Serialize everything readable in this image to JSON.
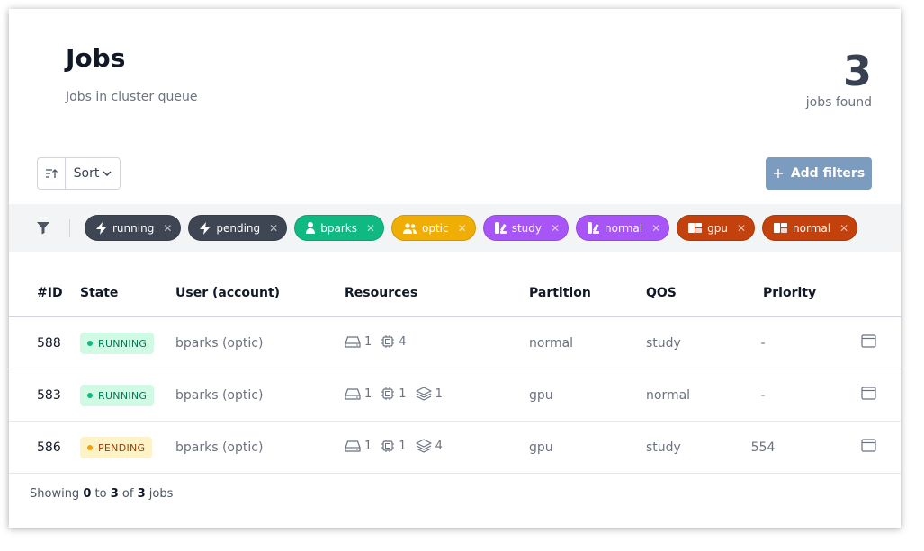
{
  "header": {
    "title": "Jobs",
    "subtitle": "Jobs in cluster queue",
    "count": "3",
    "count_label": "jobs found"
  },
  "toolbar": {
    "sort_label": "Sort",
    "add_filters_label": "Add filters"
  },
  "filters": [
    {
      "label": "running",
      "kind": "state",
      "icon": "bolt-icon"
    },
    {
      "label": "pending",
      "kind": "state",
      "icon": "bolt-icon"
    },
    {
      "label": "bparks",
      "kind": "user",
      "icon": "user-icon"
    },
    {
      "label": "optic",
      "kind": "account",
      "icon": "users-icon"
    },
    {
      "label": "study",
      "kind": "qos",
      "icon": "qos-icon"
    },
    {
      "label": "normal",
      "kind": "qos",
      "icon": "qos-icon"
    },
    {
      "label": "gpu",
      "kind": "partition",
      "icon": "partition-icon"
    },
    {
      "label": "normal",
      "kind": "partition",
      "icon": "partition-icon"
    }
  ],
  "table": {
    "columns": [
      "#ID",
      "State",
      "User (account)",
      "Resources",
      "Partition",
      "QOS",
      "Priority"
    ],
    "rows": [
      {
        "id": "588",
        "state": "RUNNING",
        "user": "bparks (optic)",
        "nodes": "1",
        "cpus": "4",
        "gpus": "",
        "partition": "normal",
        "qos": "study",
        "priority": "-"
      },
      {
        "id": "583",
        "state": "RUNNING",
        "user": "bparks (optic)",
        "nodes": "1",
        "cpus": "1",
        "gpus": "1",
        "partition": "gpu",
        "qos": "normal",
        "priority": "-"
      },
      {
        "id": "586",
        "state": "PENDING",
        "user": "bparks (optic)",
        "nodes": "1",
        "cpus": "1",
        "gpus": "4",
        "partition": "gpu",
        "qos": "study",
        "priority": "554"
      }
    ]
  },
  "footer": {
    "prefix": "Showing",
    "from": "0",
    "to_word": "to",
    "to": "3",
    "of_word": "of",
    "total": "3",
    "suffix": "jobs"
  },
  "colors": {
    "state_chip": "#3f4653",
    "user_chip": "#10b981",
    "account_chip": "#f0ae05",
    "qos_chip": "#a855f7",
    "partition_chip": "#c2410c",
    "add_filters_button": "#7c9cbf"
  }
}
